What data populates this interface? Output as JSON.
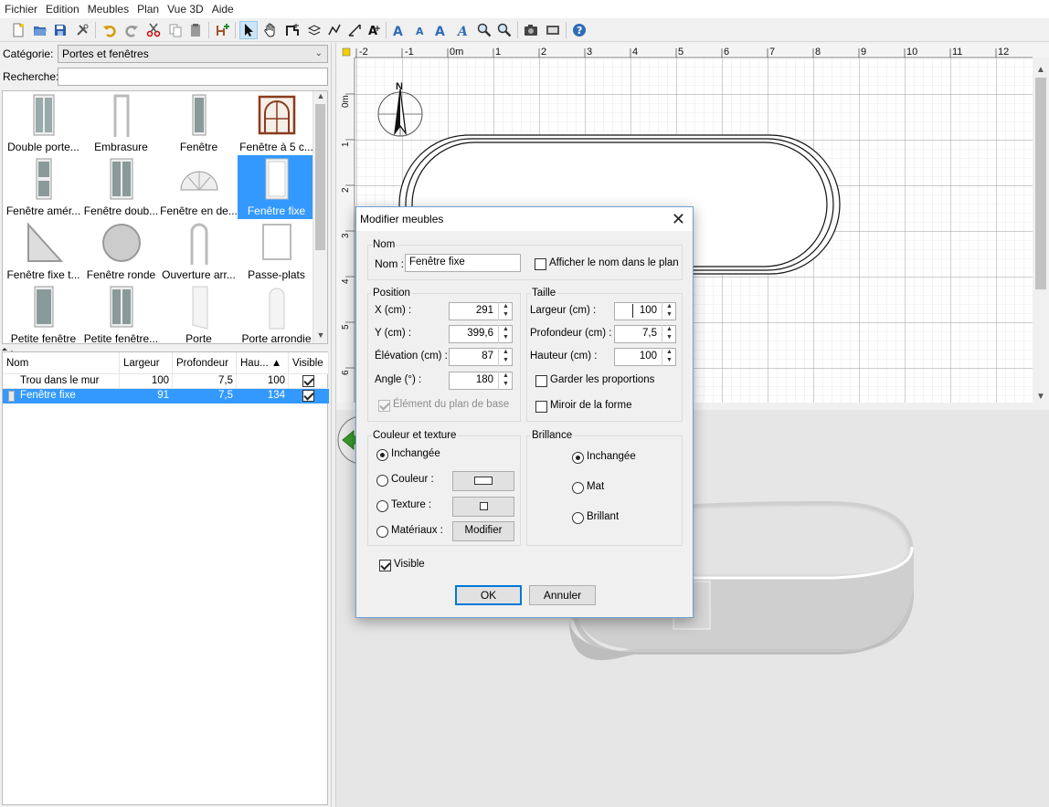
{
  "menubar": {
    "items": [
      "Fichier",
      "Edition",
      "Meubles",
      "Plan",
      "Vue 3D",
      "Aide"
    ]
  },
  "toolbar": {
    "buttons": [
      "new-file-icon",
      "open-folder-icon",
      "save-icon",
      "preferences-icon",
      "undo-icon",
      "redo-icon",
      "cut-icon",
      "copy-icon",
      "paste-icon",
      "add-furniture-icon",
      "select-arrow-icon",
      "pan-hand-icon",
      "create-walls-icon",
      "create-rooms-icon",
      "create-polylines-icon",
      "create-dimensions-icon",
      "add-text-icon",
      "increase-text-size-icon",
      "decrease-text-size-icon",
      "bold-text-icon",
      "italic-text-icon",
      "zoom-in-icon",
      "zoom-out-icon",
      "create-photo-icon",
      "create-video-icon",
      "help-icon"
    ]
  },
  "left_panel": {
    "category_label": "Catégorie:",
    "category_value": "Portes et fenêtres",
    "search_label": "Recherche:",
    "search_value": "",
    "catalog": [
      {
        "name": "Double porte...",
        "selected": false
      },
      {
        "name": "Embrasure",
        "selected": false
      },
      {
        "name": "Fenêtre",
        "selected": false
      },
      {
        "name": "Fenêtre à 5 c...",
        "selected": false
      },
      {
        "name": "Fenêtre amér...",
        "selected": false
      },
      {
        "name": "Fenêtre doub...",
        "selected": false
      },
      {
        "name": "Fenêtre en de...",
        "selected": false
      },
      {
        "name": "Fenêtre fixe",
        "selected": true
      },
      {
        "name": "Fenêtre fixe t...",
        "selected": false
      },
      {
        "name": "Fenêtre ronde",
        "selected": false
      },
      {
        "name": "Ouverture arr...",
        "selected": false
      },
      {
        "name": "Passe-plats",
        "selected": false
      },
      {
        "name": "Petite fenêtre",
        "selected": false
      },
      {
        "name": "Petite fenêtre...",
        "selected": false
      },
      {
        "name": "Porte",
        "selected": false
      },
      {
        "name": "Porte arrondie",
        "selected": false
      }
    ],
    "table": {
      "headers": [
        "Nom",
        "Largeur",
        "Profondeur",
        "Hau... ▲",
        "Visible"
      ],
      "rows": [
        {
          "name": "Trou dans le mur",
          "largeur": "100",
          "profondeur": "7,5",
          "hauteur": "100",
          "visible": true,
          "selected": false
        },
        {
          "name": "Fenêtre fixe",
          "largeur": "91",
          "profondeur": "7,5",
          "hauteur": "134",
          "visible": true,
          "selected": true
        }
      ]
    }
  },
  "plan": {
    "ruler_x": [
      "-2",
      "-1",
      "0m",
      "1",
      "2",
      "3",
      "4",
      "5",
      "6",
      "7",
      "8",
      "9",
      "10",
      "11",
      "12"
    ],
    "ruler_y": [
      "0m",
      "1",
      "2",
      "3",
      "4",
      "5",
      "6"
    ],
    "compass_label": "N"
  },
  "dialog": {
    "title": "Modifier meubles",
    "nom_group": "Nom",
    "nom_label": "Nom :",
    "nom_value": "Fenêtre fixe",
    "show_name_label": "Afficher le nom dans le plan",
    "show_name_checked": false,
    "position_group": "Position",
    "x_label": "X (cm) :",
    "x_value": "291",
    "y_label": "Y (cm) :",
    "y_value": "399,6",
    "elev_label": "Élévation (cm) :",
    "elev_value": "87",
    "angle_label": "Angle (°) :",
    "angle_value": "180",
    "base_plan_label": "Élément du plan de base",
    "base_plan_checked": true,
    "taille_group": "Taille",
    "largeur_label": "Largeur (cm) :",
    "largeur_value": "100",
    "profondeur_label": "Profondeur (cm) :",
    "profondeur_value": "7,5",
    "hauteur_label": "Hauteur (cm) :",
    "hauteur_value": "100",
    "keep_prop_label": "Garder les proportions",
    "keep_prop_checked": false,
    "mirror_label": "Miroir de la forme",
    "mirror_checked": false,
    "color_group": "Couleur et texture",
    "color_unchanged": "Inchangée",
    "color_color": "Couleur :",
    "color_texture": "Texture :",
    "color_materials": "Matériaux :",
    "modifier_label": "Modifier",
    "shine_group": "Brillance",
    "shine_unchanged": "Inchangée",
    "shine_mat": "Mat",
    "shine_bright": "Brillant",
    "visible_label": "Visible",
    "visible_checked": true,
    "ok_label": "OK",
    "cancel_label": "Annuler"
  },
  "colors": {
    "selection": "#3399ff",
    "accent": "#0078d7",
    "grid": "#d0d0d0"
  }
}
